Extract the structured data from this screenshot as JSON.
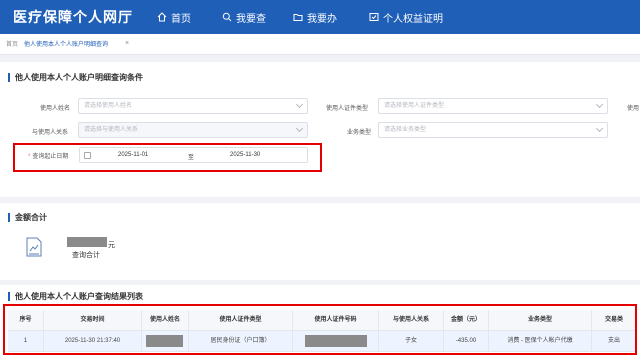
{
  "header": {
    "brand": "医疗保障个人网厅",
    "nav": [
      {
        "label": "首页",
        "icon": "home-icon"
      },
      {
        "label": "我要查",
        "icon": "search-icon"
      },
      {
        "label": "我要办",
        "icon": "folder-icon"
      },
      {
        "label": "个人权益证明",
        "icon": "certificate-icon"
      }
    ]
  },
  "tabs": {
    "home": "首页",
    "active": "他人使用本人个人账户明细查询",
    "close": "×"
  },
  "query": {
    "title": "他人使用本人个人账户明细查询条件",
    "user_name_label": "使用人姓名",
    "user_name_placeholder": "请选择使用人姓名",
    "id_type_label": "使用人证件类型",
    "id_type_placeholder": "请选择使用人证件类型",
    "third_label": "使用",
    "relation_label": "与使用人关系",
    "relation_placeholder": "请选择与使用人关系",
    "biz_type_label": "业务类型",
    "biz_type_placeholder": "请选择业务类型",
    "date_required": "*",
    "date_label": "查询起止日期",
    "date_start": "2025-11-01",
    "date_sep": "至",
    "date_end": "2025-11-30"
  },
  "amount": {
    "title": "金额合计",
    "unit": "元",
    "label": "查询合计",
    "icon": "chart-doc-icon"
  },
  "results": {
    "title": "他人使用本人个人账户查询结果列表",
    "columns": [
      "序号",
      "交易时间",
      "使用人姓名",
      "使用人证件类型",
      "使用人证件号码",
      "与使用人关系",
      "金额（元）",
      "业务类型",
      "交易类"
    ],
    "rows": [
      [
        "1",
        "2025-11-30 21:37:40",
        "",
        "居民身份证（户口簿）",
        "",
        "子女",
        "-435.00",
        "消费 - 医保个人帐户代缴",
        "支出"
      ]
    ]
  },
  "colors": {
    "nav_bg": "#1f5fb8",
    "highlight": "#e50000",
    "mask": "#8a8a8a"
  }
}
